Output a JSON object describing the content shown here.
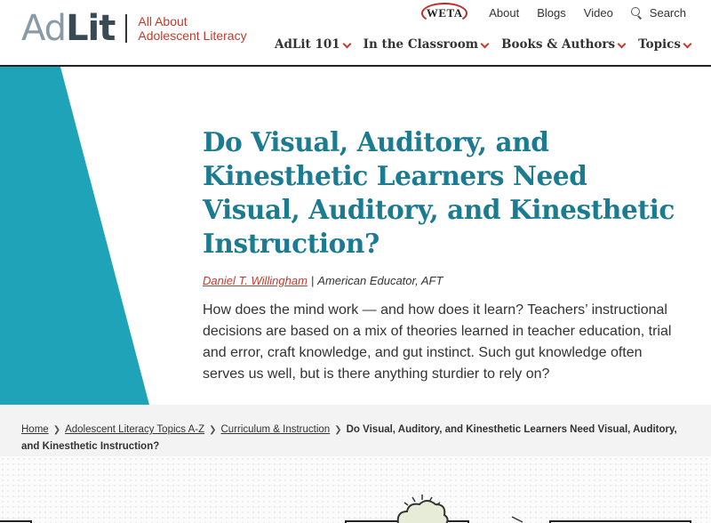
{
  "header": {
    "logo": {
      "ad": "Ad",
      "lit": "Lit",
      "tagline_line1": "All About",
      "tagline_line2": "Adolescent Literacy"
    },
    "utility": {
      "weta": "WETA",
      "about": "About",
      "blogs": "Blogs",
      "video": "Video",
      "search": "Search"
    },
    "nav": [
      {
        "label": "AdLit 101"
      },
      {
        "label": "In the Classroom"
      },
      {
        "label": "Books & Authors"
      },
      {
        "label": "Topics"
      }
    ]
  },
  "article": {
    "title": "Do Visual, Auditory, and Kinesthetic Learners Need Visual, Auditory, and Kinesthetic Instruction?",
    "author": "Daniel T. Willingham",
    "byline_separator": "|",
    "source": "American Educator, AFT",
    "intro": "How does the mind work — and how does it learn? Teachers’ instructional decisions are based on a mix of theories learned in teacher education, trial and error, craft knowledge, and gut instinct. Such gut knowledge often serves us well, but is there anything sturdier to rely on?"
  },
  "breadcrumb": {
    "items": [
      {
        "label": "Home"
      },
      {
        "label": "Adolescent Literacy Topics A-Z"
      },
      {
        "label": "Curriculum & Instruction"
      }
    ],
    "current": "Do Visual, Auditory, and Kinesthetic Learners Need Visual, Auditory, and Kinesthetic Instruction?"
  },
  "colors": {
    "teal": "#1b7b91",
    "hero_band": "#1ea3b8",
    "accent_red": "#c33a2c",
    "logo_gray": "#8a9aa6"
  }
}
